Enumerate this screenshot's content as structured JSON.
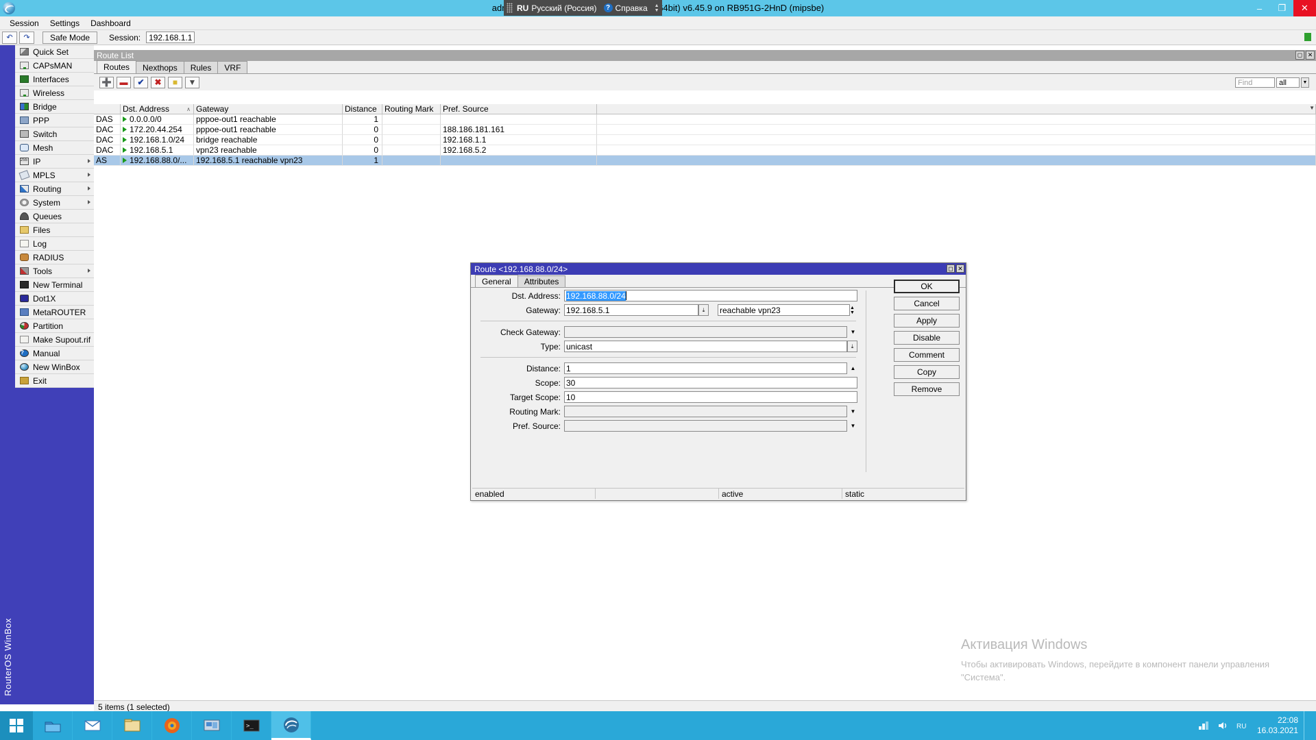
{
  "window": {
    "title": "admin@192.168.1.1 (MikroTik) - WinBox (64bit) v6.45.9 on RB951G-2HnD (mipsbe)",
    "minimize": "–",
    "maximize": "❐",
    "close": "✕",
    "logo_icon": "winbox-logo-icon"
  },
  "langbar": {
    "grip_icon": "drag-grip-icon",
    "lang_code": "RU",
    "lang_name": "Русский (Россия)",
    "help_icon": "help-icon",
    "help_label": "Справка",
    "updown_icon": "minimize-restore-icon"
  },
  "menubar": {
    "items": [
      {
        "label": "Session"
      },
      {
        "label": "Settings"
      },
      {
        "label": "Dashboard"
      }
    ]
  },
  "toolbar": {
    "undo_icon": "undo-icon",
    "redo_icon": "redo-icon",
    "safe_mode": "Safe Mode",
    "session_label": "Session:",
    "session_value": "192.168.1.1"
  },
  "sidebar": {
    "vertical_label": "RouterOS WinBox",
    "items": [
      {
        "label": "Quick Set",
        "icon": "quick-set-icon",
        "submenu": false
      },
      {
        "label": "CAPsMAN",
        "icon": "capsman-icon",
        "submenu": false
      },
      {
        "label": "Interfaces",
        "icon": "interfaces-icon",
        "submenu": false
      },
      {
        "label": "Wireless",
        "icon": "wireless-icon",
        "submenu": false
      },
      {
        "label": "Bridge",
        "icon": "bridge-icon",
        "submenu": false
      },
      {
        "label": "PPP",
        "icon": "ppp-icon",
        "submenu": false
      },
      {
        "label": "Switch",
        "icon": "switch-icon",
        "submenu": false
      },
      {
        "label": "Mesh",
        "icon": "mesh-icon",
        "submenu": false
      },
      {
        "label": "IP",
        "icon": "ip-icon",
        "submenu": true
      },
      {
        "label": "MPLS",
        "icon": "mpls-icon",
        "submenu": true
      },
      {
        "label": "Routing",
        "icon": "routing-icon",
        "submenu": true
      },
      {
        "label": "System",
        "icon": "system-icon",
        "submenu": true
      },
      {
        "label": "Queues",
        "icon": "queues-icon",
        "submenu": false
      },
      {
        "label": "Files",
        "icon": "files-icon",
        "submenu": false
      },
      {
        "label": "Log",
        "icon": "log-icon",
        "submenu": false
      },
      {
        "label": "RADIUS",
        "icon": "radius-icon",
        "submenu": false
      },
      {
        "label": "Tools",
        "icon": "tools-icon",
        "submenu": true
      },
      {
        "label": "New Terminal",
        "icon": "new-terminal-icon",
        "submenu": false
      },
      {
        "label": "Dot1X",
        "icon": "dot1x-icon",
        "submenu": false
      },
      {
        "label": "MetaROUTER",
        "icon": "metarouter-icon",
        "submenu": false
      },
      {
        "label": "Partition",
        "icon": "partition-icon",
        "submenu": false
      },
      {
        "label": "Make Supout.rif",
        "icon": "make-supout-icon",
        "submenu": false
      },
      {
        "label": "Manual",
        "icon": "manual-icon",
        "submenu": false
      },
      {
        "label": "New WinBox",
        "icon": "new-winbox-icon",
        "submenu": false
      },
      {
        "label": "Exit",
        "icon": "exit-icon",
        "submenu": false
      }
    ]
  },
  "route_list": {
    "title": "Route List",
    "restore_icon": "restore-icon",
    "close_icon": "close-icon",
    "tabs": [
      {
        "label": "Routes",
        "active": true
      },
      {
        "label": "Nexthops",
        "active": false
      },
      {
        "label": "Rules",
        "active": false
      },
      {
        "label": "VRF",
        "active": false
      }
    ],
    "tools": [
      {
        "icon": "add-icon",
        "glyph": "✚",
        "color": "#1a3fa0"
      },
      {
        "icon": "remove-icon",
        "glyph": "➖",
        "color": "#c02020"
      },
      {
        "icon": "enable-icon",
        "glyph": "✔",
        "color": "#1a3fa0"
      },
      {
        "icon": "disable-icon",
        "glyph": "✖",
        "color": "#c02020"
      },
      {
        "icon": "comment-icon",
        "glyph": "⬛",
        "color": "#e8c83c"
      },
      {
        "icon": "filter-icon",
        "glyph": "▽",
        "color": "#4a4a4a"
      }
    ],
    "find_placeholder": "Find",
    "find_value": "",
    "filter_scope": "all",
    "columns": [
      "",
      "Dst. Address",
      "Gateway",
      "Distance",
      "Routing Mark",
      "Pref. Source"
    ],
    "sorted_column": "Dst. Address",
    "rows": [
      {
        "flags": "DAS",
        "dst": "0.0.0.0/0",
        "gateway": "pppoe-out1 reachable",
        "distance": "1",
        "mark": "",
        "pref_source": "",
        "selected": false
      },
      {
        "flags": "DAC",
        "dst": "172.20.44.254",
        "gateway": "pppoe-out1 reachable",
        "distance": "0",
        "mark": "",
        "pref_source": "188.186.181.161",
        "selected": false
      },
      {
        "flags": "DAC",
        "dst": "192.168.1.0/24",
        "gateway": "bridge reachable",
        "distance": "0",
        "mark": "",
        "pref_source": "192.168.1.1",
        "selected": false
      },
      {
        "flags": "DAC",
        "dst": "192.168.5.1",
        "gateway": "vpn23 reachable",
        "distance": "0",
        "mark": "",
        "pref_source": "192.168.5.2",
        "selected": false
      },
      {
        "flags": "AS",
        "dst": "192.168.88.0/...",
        "gateway": "192.168.5.1 reachable vpn23",
        "distance": "1",
        "mark": "",
        "pref_source": "",
        "selected": true
      }
    ],
    "status": "5 items (1 selected)"
  },
  "dialog": {
    "title": "Route <192.168.88.0/24>",
    "restore_icon": "restore-icon",
    "close_icon": "close-icon",
    "tabs": [
      {
        "label": "General",
        "active": true
      },
      {
        "label": "Attributes",
        "active": false
      }
    ],
    "fields": [
      {
        "label": "Dst. Address:",
        "value": "192.168.88.0/24",
        "selected": true,
        "disabled": false,
        "control": "text"
      },
      {
        "label": "Gateway:",
        "value": "192.168.5.1",
        "value2": "reachable vpn23",
        "selected": false,
        "disabled": false,
        "control": "gateway"
      },
      {
        "label": "Check Gateway:",
        "value": "",
        "selected": false,
        "disabled": true,
        "control": "dropdown"
      },
      {
        "label": "Type:",
        "value": "unicast",
        "selected": false,
        "disabled": false,
        "control": "dropdown-btn"
      },
      {
        "label": "Distance:",
        "value": "1",
        "selected": false,
        "disabled": false,
        "control": "spinner"
      },
      {
        "label": "Scope:",
        "value": "30",
        "selected": false,
        "disabled": false,
        "control": "text"
      },
      {
        "label": "Target Scope:",
        "value": "10",
        "selected": false,
        "disabled": false,
        "control": "text"
      },
      {
        "label": "Routing Mark:",
        "value": "",
        "selected": false,
        "disabled": true,
        "control": "dropdown"
      },
      {
        "label": "Pref. Source:",
        "value": "",
        "selected": false,
        "disabled": true,
        "control": "dropdown"
      }
    ],
    "buttons": [
      {
        "label": "OK",
        "default": true
      },
      {
        "label": "Cancel",
        "default": false
      },
      {
        "label": "Apply",
        "default": false
      },
      {
        "label": "Disable",
        "default": false
      },
      {
        "label": "Comment",
        "default": false
      },
      {
        "label": "Copy",
        "default": false
      },
      {
        "label": "Remove",
        "default": false
      }
    ],
    "status": [
      "enabled",
      "",
      "active",
      "static"
    ]
  },
  "watermark": {
    "title": "Активация Windows",
    "subtitle": "Чтобы активировать Windows, перейдите в компонент панели управления \"Система\"."
  },
  "taskbar": {
    "start_icon": "windows-start-icon",
    "items": [
      {
        "icon": "folder-explorer-icon",
        "active": false
      },
      {
        "icon": "mail-icon",
        "active": false
      },
      {
        "icon": "file-manager-icon",
        "active": false
      },
      {
        "icon": "firefox-icon",
        "active": false
      },
      {
        "icon": "remote-desktop-icon",
        "active": false
      },
      {
        "icon": "terminal-icon",
        "active": false
      },
      {
        "icon": "winbox-icon",
        "active": true
      }
    ],
    "tray_icons": [
      "network-icon",
      "volume-icon",
      "language-icon"
    ],
    "clock_time": "22:08",
    "clock_date": "16.03.2021",
    "show_desktop_icon": "show-desktop-icon"
  }
}
